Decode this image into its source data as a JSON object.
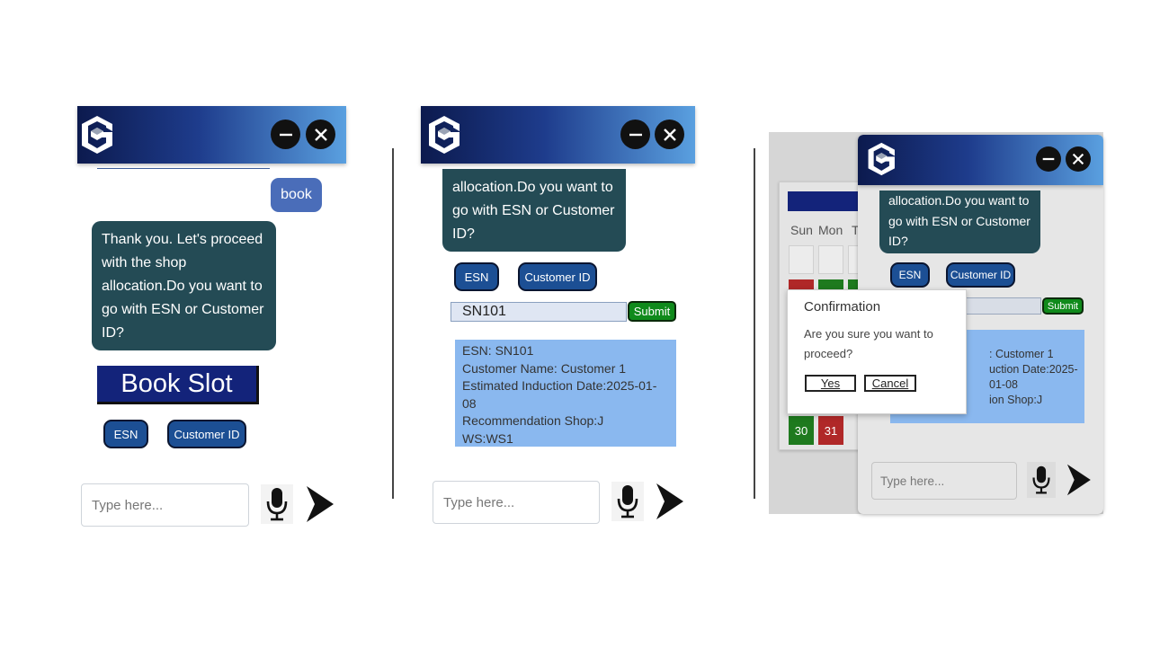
{
  "colors": {
    "header_dark": "#0c1a4e",
    "header_light": "#5aa0e0",
    "bot_bubble": "#244b55",
    "user_bubble": "#4a6db9",
    "option_button": "#1c4f94",
    "submit_green": "#0f8a1b",
    "info_card": "#8ab8ef",
    "calendar_green": "#1e7a1e",
    "calendar_red": "#b02828"
  },
  "icons": {
    "logo": "company-logo",
    "minimize": "minimize-icon",
    "close": "close-icon",
    "microphone": "microphone-icon",
    "send": "send-icon"
  },
  "panel1": {
    "user_message": "book",
    "bot_message_lines": [
      "Thank you. Let's proceed",
      "with the shop",
      "allocation.Do you want to",
      "go with ESN or Customer",
      "ID?"
    ],
    "book_slot_label": "Book Slot",
    "esn_button": "ESN",
    "customer_id_button": "Customer ID",
    "input_placeholder": "Type here..."
  },
  "panel2": {
    "bot_message_lines": [
      "allocation.Do you want to",
      "go with ESN or Customer",
      "ID?"
    ],
    "esn_button": "ESN",
    "customer_id_button": "Customer ID",
    "esn_value": "SN101",
    "submit_label": "Submit",
    "info_lines": [
      "ESN: SN101",
      "Customer Name: Customer 1",
      "Estimated Induction Date:2025-01-08",
      "Recommendation Shop:J",
      "WS:WS1"
    ],
    "input_placeholder": "Type here..."
  },
  "panel3": {
    "calendar_days": [
      "Sun",
      "Mon",
      "T"
    ],
    "calendar_dates": [
      "30",
      "31"
    ],
    "bot_message_lines": [
      "allocation.Do you want to",
      "go with ESN or Customer",
      "ID?"
    ],
    "esn_button": "ESN",
    "customer_id_button": "Customer ID",
    "submit_label": "Submit",
    "info_lines_partial": [
      ": Customer 1",
      "uction Date:2025-01-08",
      "ion Shop:J"
    ],
    "dialog": {
      "title": "Confirmation",
      "message_lines": [
        "Are you sure you want to",
        "proceed?"
      ],
      "yes_label": "Yes",
      "cancel_label": "Cancel"
    },
    "input_placeholder": "Type here..."
  }
}
